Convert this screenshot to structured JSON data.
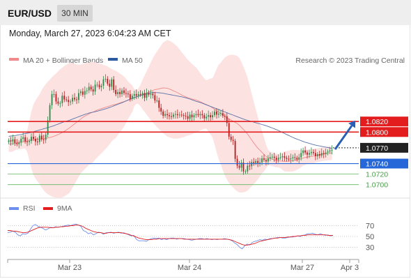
{
  "header": {
    "symbol": "EUR/USD",
    "timeframe": "30 MIN"
  },
  "datetime": "Monday, March 27, 2023 6:04:23 AM CET",
  "legend": {
    "bb_label": "MA 20 + Bollinger Bands",
    "ma50_label": "MA 50",
    "copyright": "Research © 2023 Trading Central",
    "rsi_label": "RSI",
    "rsi_ma_label": "9MA"
  },
  "colors": {
    "resistance": "#e31d1d",
    "support": "#2566d8",
    "minor_support": "#62b862",
    "candle_up": "#2e8b4a",
    "candle_down": "#b81c1c",
    "ma20": "#f08a8a",
    "band_fill": "#fde2e2",
    "ma50": "#5b73a8",
    "rsi": "#6b8ef0",
    "rsi_ma": "#e31d1d",
    "arrow": "#2b5fb5",
    "current_price_bg": "#222222"
  },
  "chart_data": [
    {
      "type": "candlestick",
      "title": "",
      "x_ticks": [
        "Mar 23",
        "Mar 24",
        "Mar 27",
        "Apr 3"
      ],
      "y_levels": [
        {
          "value": 1.082,
          "label": "1.0820",
          "kind": "resistance"
        },
        {
          "value": 1.08,
          "label": "1.0800",
          "kind": "resistance"
        },
        {
          "value": 1.077,
          "label": "1.0770",
          "kind": "current"
        },
        {
          "value": 1.074,
          "label": "1.0740",
          "kind": "pivot"
        },
        {
          "value": 1.072,
          "label": "1.0720",
          "kind": "support"
        },
        {
          "value": 1.07,
          "label": "1.0700",
          "kind": "support"
        }
      ],
      "ylim": [
        1.0685,
        1.0925
      ],
      "close": [
        1.0784,
        1.0782,
        1.0786,
        1.0779,
        1.0777,
        1.078,
        1.0787,
        1.079,
        1.0782,
        1.0781,
        1.0783,
        1.0791,
        1.0787,
        1.0782,
        1.0781,
        1.0793,
        1.0786,
        1.0785,
        1.0795,
        1.0822,
        1.0851,
        1.0872,
        1.0872,
        1.0858,
        1.0854,
        1.0855,
        1.0869,
        1.0862,
        1.0861,
        1.0857,
        1.0858,
        1.0865,
        1.0862,
        1.0861,
        1.0874,
        1.0877,
        1.0871,
        1.0878,
        1.0879,
        1.0886,
        1.0881,
        1.0877,
        1.089,
        1.089,
        1.0885,
        1.0888,
        1.09,
        1.0901,
        1.0892,
        1.0886,
        1.09,
        1.088,
        1.0872,
        1.0876,
        1.0872,
        1.0879,
        1.0874,
        1.0873,
        1.0872,
        1.0863,
        1.0869,
        1.0872,
        1.0869,
        1.0872,
        1.0871,
        1.0874,
        1.0865,
        1.0874,
        1.0871,
        1.0873,
        1.087,
        1.086,
        1.086,
        1.0846,
        1.0839,
        1.0831,
        1.0834,
        1.0832,
        1.083,
        1.0829,
        1.0833,
        1.0834,
        1.0832,
        1.0833,
        1.0832,
        1.0831,
        1.083,
        1.0825,
        1.0833,
        1.0828,
        1.0832,
        1.0834,
        1.0832,
        1.0834,
        1.0832,
        1.0826,
        1.0829,
        1.0832,
        1.0828,
        1.0832,
        1.0839,
        1.0833,
        1.0835,
        1.0836,
        1.0831,
        1.083,
        1.0817,
        1.0791,
        1.0785,
        1.0783,
        1.0749,
        1.0736,
        1.0732,
        1.0742,
        1.0725,
        1.0725,
        1.0736,
        1.0735,
        1.0743,
        1.0741,
        1.0745,
        1.0741,
        1.0742,
        1.075,
        1.0747,
        1.0744,
        1.075,
        1.0752,
        1.0753,
        1.0751,
        1.0747,
        1.0751,
        1.0752,
        1.0754,
        1.0751,
        1.0749,
        1.0748,
        1.075,
        1.0752,
        1.0751,
        1.0748,
        1.0752,
        1.076,
        1.0765,
        1.0761,
        1.0757,
        1.076,
        1.0762,
        1.076,
        1.0754,
        1.0758,
        1.0755,
        1.076,
        1.0758,
        1.0761,
        1.0763,
        1.0765,
        1.0766
      ],
      "ma20": [
        1.0777,
        1.0778,
        1.078,
        1.0781,
        1.0783,
        1.0785,
        1.0786,
        1.0787,
        1.0788,
        1.079,
        1.0793,
        1.0797,
        1.0802,
        1.0808,
        1.0815,
        1.0822,
        1.0829,
        1.0834,
        1.0838,
        1.0842,
        1.0845,
        1.0848,
        1.0851,
        1.0853,
        1.0856,
        1.0859,
        1.0862,
        1.0866,
        1.0869,
        1.0873,
        1.0876,
        1.088,
        1.0882,
        1.0884,
        1.0883,
        1.0879,
        1.0875,
        1.087,
        1.0866,
        1.0863,
        1.0861,
        1.0857,
        1.0853,
        1.0849,
        1.0843,
        1.0837,
        1.083,
        1.0825,
        1.082,
        1.0815,
        1.0806,
        1.0796,
        1.0783,
        1.0771,
        1.0762,
        1.0753,
        1.0749,
        1.0746,
        1.0745,
        1.0744,
        1.0745,
        1.0746,
        1.0748,
        1.0751,
        1.0753,
        1.0754,
        1.0756,
        1.0758,
        1.0759,
        1.076
      ],
      "ma50": [
        1.0792,
        1.0793,
        1.0795,
        1.0797,
        1.0799,
        1.0802,
        1.0805,
        1.0808,
        1.0811,
        1.0815,
        1.0819,
        1.0822,
        1.0826,
        1.083,
        1.0834,
        1.0837,
        1.0839,
        1.0842,
        1.0845,
        1.0849,
        1.0853,
        1.0857,
        1.0862,
        1.0866,
        1.0869,
        1.0872,
        1.0875,
        1.0875,
        1.0874,
        1.0872,
        1.087,
        1.0868,
        1.0866,
        1.0863,
        1.0859,
        1.0856,
        1.0852,
        1.0848,
        1.0844,
        1.084,
        1.0836,
        1.0832,
        1.0828,
        1.0824,
        1.0821,
        1.0818,
        1.0815,
        1.0812,
        1.0808,
        1.0804,
        1.0799,
        1.0794,
        1.0789,
        1.0785,
        1.0781,
        1.0778,
        1.0775,
        1.0773,
        1.0771,
        1.0769
      ],
      "projection": {
        "from": 1.0767,
        "to": 1.082
      }
    },
    {
      "type": "line",
      "title": "",
      "series": [
        {
          "name": "RSI",
          "values": [
            57,
            58,
            60,
            58,
            53,
            51,
            55,
            54,
            56,
            63,
            70,
            72,
            69,
            67,
            65,
            62,
            64,
            67,
            66,
            68,
            67,
            68,
            69,
            70,
            71,
            70,
            72,
            73,
            71,
            69,
            61,
            59,
            55,
            57,
            53,
            55,
            58,
            57,
            54,
            57,
            57,
            58,
            56,
            57,
            58,
            56,
            57,
            55,
            53,
            51,
            52,
            45,
            42,
            42,
            42,
            41,
            44,
            46,
            47,
            46,
            47,
            44,
            46,
            44,
            46,
            47,
            47,
            45,
            46,
            46,
            46,
            45,
            44,
            43,
            44,
            45,
            46,
            46,
            45,
            46,
            45,
            44,
            45,
            44,
            45,
            45,
            46,
            45,
            44,
            42,
            38,
            35,
            30,
            27,
            33,
            36,
            34,
            39,
            41,
            42,
            44,
            43,
            45,
            44,
            46,
            46,
            47,
            48,
            48,
            47,
            47,
            48,
            49,
            49,
            50,
            51,
            50,
            52,
            53,
            55,
            55,
            56,
            54,
            53,
            55,
            53,
            52,
            53,
            51,
            52
          ]
        },
        {
          "name": "9MA",
          "values": [
            61,
            61,
            60,
            60,
            59,
            58,
            57,
            57,
            58,
            60,
            62,
            64,
            66,
            67,
            67,
            67,
            67,
            66,
            66,
            67,
            67,
            68,
            68,
            69,
            69,
            70,
            70,
            71,
            71,
            70,
            68,
            65,
            63,
            61,
            59,
            58,
            57,
            57,
            56,
            56,
            57,
            57,
            57,
            57,
            57,
            57,
            56,
            55,
            54,
            52,
            51,
            49,
            47,
            46,
            45,
            44,
            44,
            44,
            45,
            45,
            46,
            46,
            46,
            46,
            46,
            46,
            46,
            46,
            46,
            46,
            45,
            45,
            45,
            45,
            45,
            45,
            45,
            45,
            45,
            45,
            45,
            45,
            45,
            45,
            45,
            45,
            45,
            45,
            44,
            43,
            41,
            39,
            37,
            35,
            34,
            34,
            35,
            36,
            37,
            39,
            41,
            42,
            43,
            44,
            45,
            46,
            47,
            47,
            48,
            48,
            48,
            49,
            49,
            50,
            50,
            51,
            51,
            52,
            52,
            53,
            53,
            53,
            53,
            53,
            53,
            53,
            53,
            52,
            52,
            52
          ]
        }
      ],
      "y_ticks": [
        "70",
        "50",
        "30"
      ],
      "ylim": [
        10,
        90
      ]
    }
  ]
}
